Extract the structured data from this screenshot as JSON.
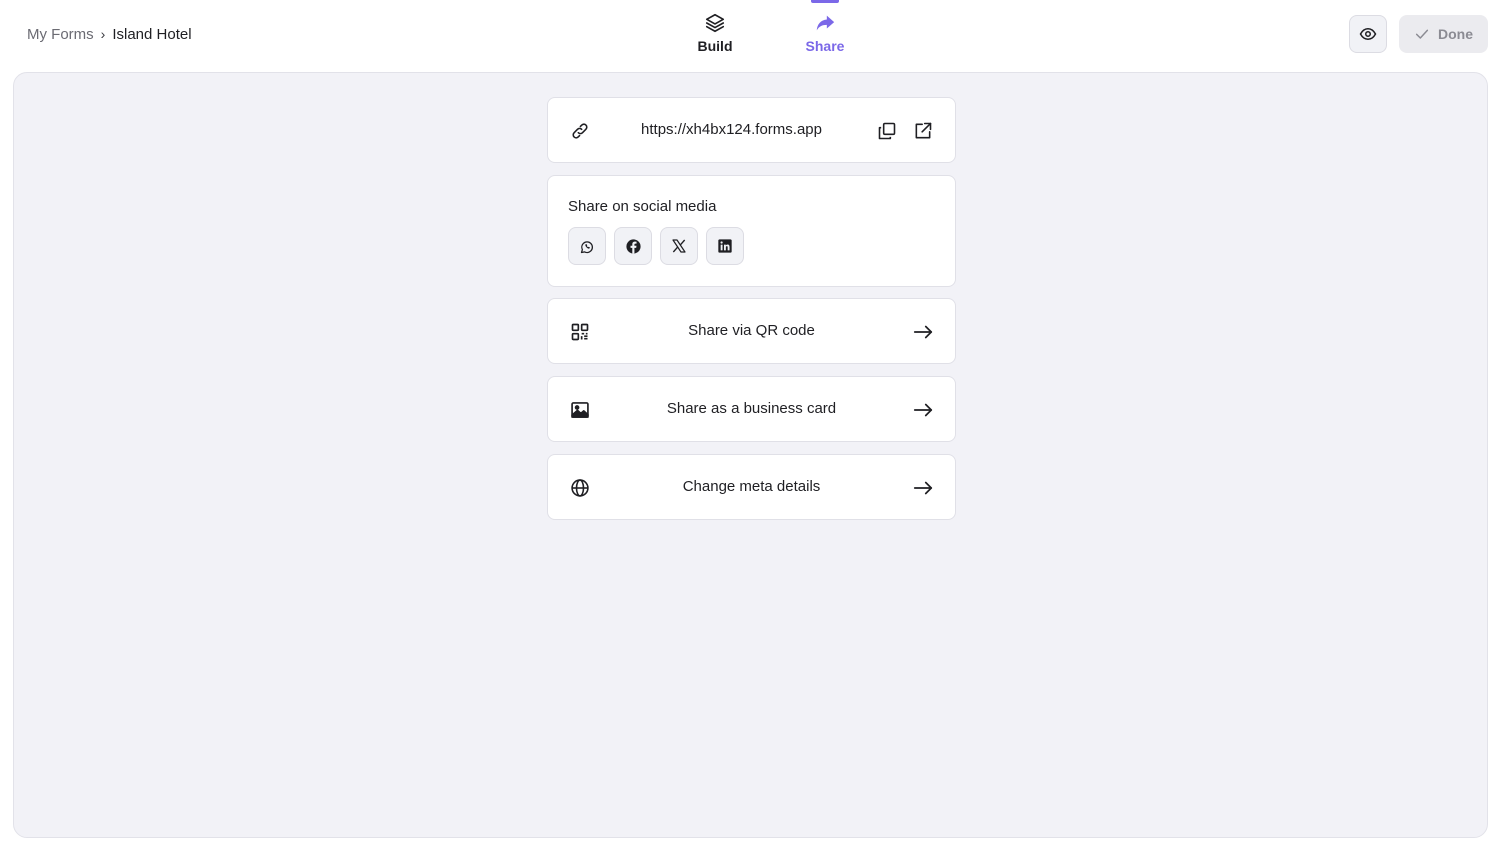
{
  "breadcrumb": {
    "root": "My Forms",
    "separator": "›",
    "current": "Island Hotel"
  },
  "tabs": [
    {
      "label": "Build",
      "icon": "layers-icon",
      "active": false
    },
    {
      "label": "Share",
      "icon": "share-arrow-icon",
      "active": true
    }
  ],
  "header": {
    "preview_icon": "eye-icon",
    "done_label": "Done"
  },
  "share_link": {
    "url": "https://xh4bx124.forms.app",
    "icon": "link-icon",
    "copy_icon": "copy-icon",
    "open_icon": "external-link-icon"
  },
  "social": {
    "title": "Share on social media",
    "networks": [
      "whatsapp-icon",
      "facebook-icon",
      "x-icon",
      "linkedin-icon"
    ]
  },
  "options": [
    {
      "label": "Share via QR code",
      "icon": "qr-code-icon"
    },
    {
      "label": "Share as a business card",
      "icon": "image-icon"
    },
    {
      "label": "Change meta details",
      "icon": "globe-icon"
    }
  ],
  "colors": {
    "accent": "#7b68e8",
    "canvas": "#f2f2f7",
    "text": "#1f1f23"
  }
}
